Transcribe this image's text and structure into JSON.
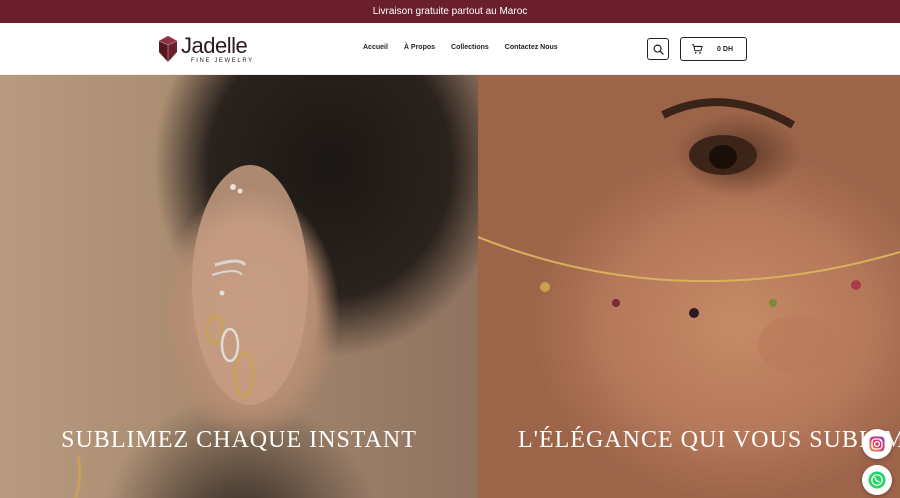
{
  "announcement": {
    "text": "Livraison gratuite partout au Maroc"
  },
  "brand": {
    "name": "Jadelle",
    "tagline": "FINE JEWELRY"
  },
  "nav": {
    "items": [
      {
        "label": "Accueil"
      },
      {
        "label": "À Propos"
      },
      {
        "label": "Collections"
      },
      {
        "label": "Contactez Nous"
      }
    ]
  },
  "header": {
    "search_icon": "search-icon",
    "cart_icon": "cart-icon",
    "cart_total": "0 DH"
  },
  "hero": {
    "left": {
      "title": "SUBLIMEZ CHAQUE INSTANT"
    },
    "right": {
      "title": "L'ÉLÉGANCE QUI VOUS SUBLIME"
    }
  },
  "floating": {
    "instagram_icon": "instagram-icon",
    "whatsapp_icon": "whatsapp-icon"
  },
  "colors": {
    "announcement_bg": "#6b1f2c",
    "accent": "#6b1f2c",
    "whatsapp": "#25d366"
  }
}
